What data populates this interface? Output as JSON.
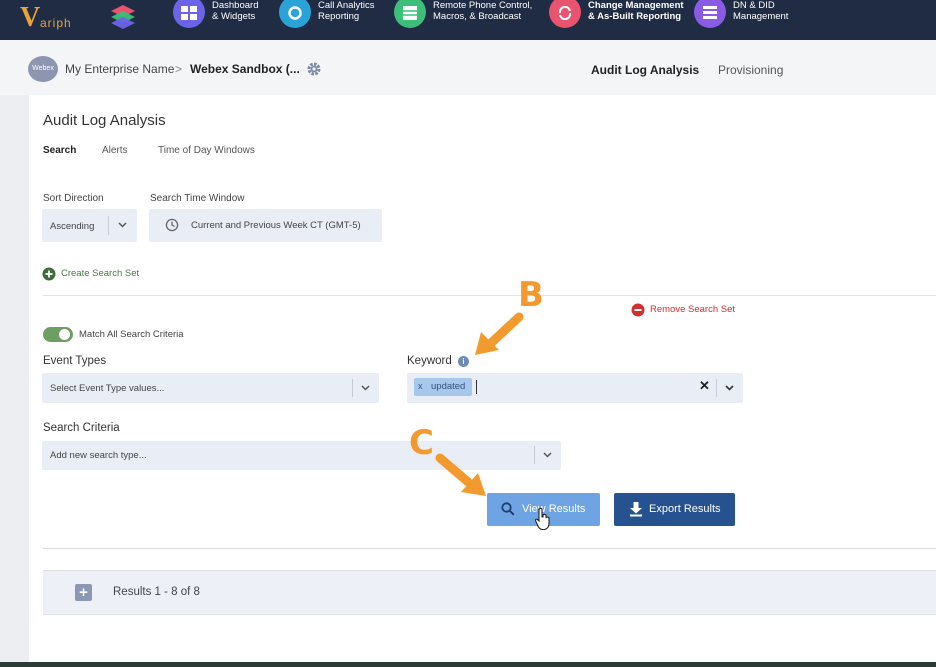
{
  "top_nav": {
    "logo_text": "ariph",
    "items": [
      {
        "line1": "Dashboard",
        "line2": "& Widgets",
        "icon": "dashboard-icon",
        "color": "#6b63e8"
      },
      {
        "line1": "Call Analytics",
        "line2": "Reporting",
        "icon": "refresh-icon",
        "color": "#2aa4d8"
      },
      {
        "line1": "Remote Phone Control,",
        "line2": "Macros, & Broadcast",
        "icon": "phone-grid-icon",
        "color": "#3bbf7a"
      },
      {
        "line1": "Change Management",
        "line2": "& As-Built Reporting",
        "icon": "sync-icon",
        "color": "#e8536d"
      },
      {
        "line1": "DN & DID",
        "line2": "Management",
        "icon": "list-icon",
        "color": "#8a5ce6"
      }
    ]
  },
  "breadcrumb": {
    "avatar": "Webex",
    "enterprise": "My Enterprise Name",
    "separator": ">",
    "current": "Webex Sandbox (..."
  },
  "header_tabs": {
    "active": "Audit Log Analysis",
    "other": "Provisioning"
  },
  "page": {
    "title": "Audit Log Analysis",
    "tabs": [
      "Search",
      "Alerts",
      "Time of Day Windows"
    ]
  },
  "sort": {
    "label": "Sort Direction",
    "value": "Ascending"
  },
  "time_window": {
    "label": "Search Time Window",
    "value": "Current and Previous Week CT (GMT-5)"
  },
  "create_search_set": "Create Search Set",
  "remove_search_set": "Remove Search Set",
  "match_all": {
    "label": "Match All Search Criteria",
    "enabled": true
  },
  "event_types": {
    "label": "Event Types",
    "placeholder": "Select Event Type values..."
  },
  "keyword": {
    "label": "Keyword",
    "chips": [
      "updated"
    ],
    "chip_remove": "x",
    "clear": "✕"
  },
  "search_criteria": {
    "label": "Search Criteria",
    "placeholder": "Add new search type..."
  },
  "buttons": {
    "view": "View Results",
    "export": "Export Results"
  },
  "results": {
    "label": "Results 1 - 8 of 8",
    "expand": "+"
  },
  "annotations": {
    "b": "B",
    "c": "C",
    "color": "#f39a2e"
  }
}
